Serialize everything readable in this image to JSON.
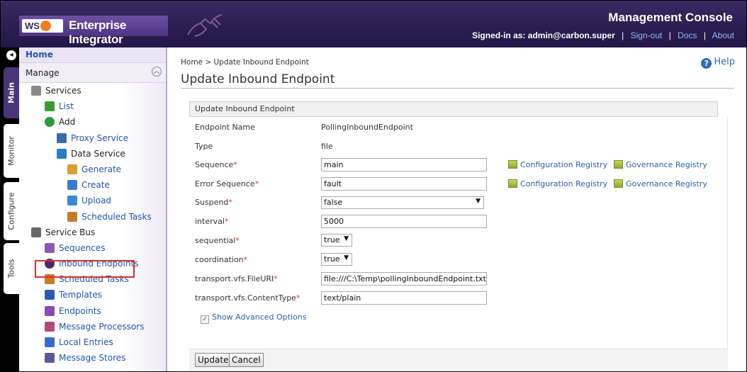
{
  "header": {
    "logo_text": "WSO2",
    "product": "Enterprise Integrator",
    "console_title": "Management Console",
    "signed_in_label": "Signed-in as:",
    "user": "admin@carbon.super",
    "links": [
      "Sign-out",
      "Docs",
      "About"
    ]
  },
  "vtabs": [
    "Main",
    "Monitor",
    "Configure",
    "Tools"
  ],
  "sidebar": {
    "home": "Home",
    "section": "Manage",
    "items": [
      {
        "label": "Services",
        "kind": "head",
        "level": 0,
        "icon": "gear-icon"
      },
      {
        "label": "List",
        "kind": "link",
        "level": 1,
        "icon": "list-icon"
      },
      {
        "label": "Add",
        "kind": "head",
        "level": 1,
        "icon": "add-icon"
      },
      {
        "label": "Proxy Service",
        "kind": "link",
        "level": 2,
        "icon": "proxy-service-icon"
      },
      {
        "label": "Data Service",
        "kind": "head",
        "level": 2,
        "icon": "data-service-icon"
      },
      {
        "label": "Generate",
        "kind": "link",
        "level": 3,
        "icon": "generate-icon"
      },
      {
        "label": "Create",
        "kind": "link",
        "level": 3,
        "icon": "create-icon"
      },
      {
        "label": "Upload",
        "kind": "link",
        "level": 3,
        "icon": "upload-icon"
      },
      {
        "label": "Scheduled Tasks",
        "kind": "link",
        "level": 3,
        "icon": "scheduled-tasks-icon"
      },
      {
        "label": "Service Bus",
        "kind": "head",
        "level": 0,
        "icon": "service-bus-icon"
      },
      {
        "label": "Sequences",
        "kind": "link",
        "level": 1,
        "icon": "sequences-icon"
      },
      {
        "label": "Inbound Endpoints",
        "kind": "link",
        "level": 1,
        "icon": "inbound-endpoints-icon"
      },
      {
        "label": "Scheduled Tasks",
        "kind": "link",
        "level": 1,
        "icon": "scheduled-tasks-icon"
      },
      {
        "label": "Templates",
        "kind": "link",
        "level": 1,
        "icon": "templates-icon"
      },
      {
        "label": "Endpoints",
        "kind": "link",
        "level": 1,
        "icon": "endpoints-icon"
      },
      {
        "label": "Message Processors",
        "kind": "link",
        "level": 1,
        "icon": "message-processors-icon"
      },
      {
        "label": "Local Entries",
        "kind": "link",
        "level": 1,
        "icon": "local-entries-icon"
      },
      {
        "label": "Message Stores",
        "kind": "link",
        "level": 1,
        "icon": "message-stores-icon"
      }
    ]
  },
  "content": {
    "breadcrumb": "Home > Update Inbound Endpoint",
    "help": "Help",
    "page_title": "Update Inbound Endpoint",
    "panel_title": "Update Inbound Endpoint",
    "fields": {
      "endpoint_name_label": "Endpoint Name",
      "endpoint_name_value": "PollingInboundEndpoint",
      "type_label": "Type",
      "type_value": "file",
      "sequence_label": "Sequence",
      "sequence_value": "main",
      "error_sequence_label": "Error Sequence",
      "error_sequence_value": "fault",
      "suspend_label": "Suspend",
      "suspend_value": "false",
      "interval_label": "interval",
      "interval_value": "5000",
      "sequential_label": "sequential",
      "sequential_value": "true",
      "coordination_label": "coordination",
      "coordination_value": "true",
      "file_uri_label": "transport.vfs.FileURI",
      "file_uri_value": "file:///C:\\Temp\\pollingInboundEndpoint.txt",
      "content_type_label": "transport.vfs.ContentType",
      "content_type_value": "text/plain"
    },
    "required_mark": "*",
    "config_registry": "Configuration Registry",
    "gov_registry": "Governance Registry",
    "advanced_options": "Show Advanced Options",
    "update_button": "Update",
    "cancel_button": "Cancel"
  }
}
